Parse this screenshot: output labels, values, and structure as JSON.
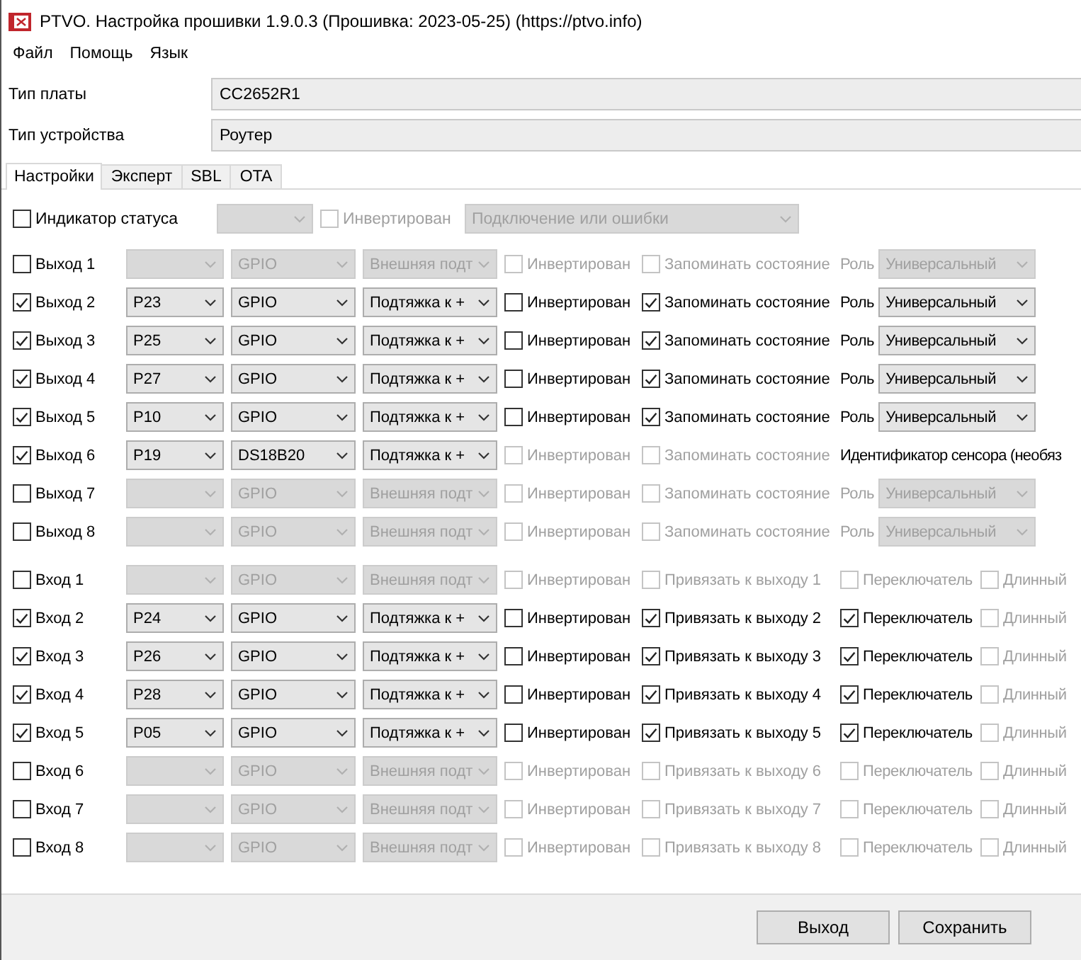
{
  "window": {
    "title": "PTVO. Настройка прошивки 1.9.0.3 (Прошивка: 2023-05-25) (https://ptvo.info)"
  },
  "menu": [
    "Файл",
    "Помощь",
    "Язык"
  ],
  "fields": [
    {
      "label": "Тип платы",
      "value": "CC2652R1"
    },
    {
      "label": "Тип устройства",
      "value": "Роутер"
    }
  ],
  "tabs": [
    {
      "label": "Настройки",
      "selected": true
    },
    {
      "label": "Эксперт",
      "selected": false
    },
    {
      "label": "SBL",
      "selected": false
    },
    {
      "label": "OTA",
      "selected": false
    }
  ],
  "status_row": {
    "label": "Индикатор статуса",
    "checked": false,
    "invert": {
      "label": "Инвертирован",
      "checked": false,
      "disabled": true
    },
    "mode": "Подключение или ошибки"
  },
  "outputs": [
    {
      "label": "Выход 1",
      "checked": false,
      "type": "GPIO",
      "pull": "Внешняя подт",
      "options": [
        {
          "label": "Инвертирован",
          "checked": false,
          "disabled": true
        },
        {
          "label": "Запоминать состояние",
          "checked": false,
          "disabled": true
        }
      ],
      "role": {
        "kind": "select",
        "label": "Роль",
        "value": "Универсальный"
      }
    },
    {
      "label": "Выход 2",
      "checked": true,
      "pin": "P23",
      "type": "GPIO",
      "pull": "Подтяжка к +",
      "options": [
        {
          "label": "Инвертирован",
          "checked": false,
          "disabled": false
        },
        {
          "label": "Запоминать состояние",
          "checked": true,
          "disabled": false
        }
      ],
      "role": {
        "kind": "select",
        "label": "Роль",
        "value": "Универсальный"
      }
    },
    {
      "label": "Выход 3",
      "checked": true,
      "pin": "P25",
      "type": "GPIO",
      "pull": "Подтяжка к +",
      "options": [
        {
          "label": "Инвертирован",
          "checked": false,
          "disabled": false
        },
        {
          "label": "Запоминать состояние",
          "checked": true,
          "disabled": false
        }
      ],
      "role": {
        "kind": "select",
        "label": "Роль",
        "value": "Универсальный"
      }
    },
    {
      "label": "Выход 4",
      "checked": true,
      "pin": "P27",
      "type": "GPIO",
      "pull": "Подтяжка к +",
      "options": [
        {
          "label": "Инвертирован",
          "checked": false,
          "disabled": false
        },
        {
          "label": "Запоминать состояние",
          "checked": true,
          "disabled": false
        }
      ],
      "role": {
        "kind": "select",
        "label": "Роль",
        "value": "Универсальный"
      }
    },
    {
      "label": "Выход 5",
      "checked": true,
      "pin": "P10",
      "type": "GPIO",
      "pull": "Подтяжка к +",
      "options": [
        {
          "label": "Инвертирован",
          "checked": false,
          "disabled": false
        },
        {
          "label": "Запоминать состояние",
          "checked": true,
          "disabled": false
        }
      ],
      "role": {
        "kind": "select",
        "label": "Роль",
        "value": "Универсальный"
      }
    },
    {
      "label": "Выход 6",
      "checked": true,
      "pin": "P19",
      "type": "DS18B20",
      "pull": "Подтяжка к +",
      "options": [
        {
          "label": "Инвертирован",
          "checked": false,
          "disabled": true
        },
        {
          "label": "Запоминать состояние",
          "checked": false,
          "disabled": true
        }
      ],
      "role": {
        "kind": "text",
        "label": "Идентификатор сенсора (необяз"
      }
    },
    {
      "label": "Выход 7",
      "checked": false,
      "type": "GPIO",
      "pull": "Внешняя подт",
      "options": [
        {
          "label": "Инвертирован",
          "checked": false,
          "disabled": true
        },
        {
          "label": "Запоминать состояние",
          "checked": false,
          "disabled": true
        }
      ],
      "role": {
        "kind": "select",
        "label": "Роль",
        "value": "Универсальный"
      }
    },
    {
      "label": "Выход 8",
      "checked": false,
      "type": "GPIO",
      "pull": "Внешняя подт",
      "options": [
        {
          "label": "Инвертирован",
          "checked": false,
          "disabled": true
        },
        {
          "label": "Запоминать состояние",
          "checked": false,
          "disabled": true
        }
      ],
      "role": {
        "kind": "select",
        "label": "Роль",
        "value": "Универсальный"
      }
    }
  ],
  "inputs": [
    {
      "label": "Вход 1",
      "checked": false,
      "type": "GPIO",
      "pull": "Внешняя подт",
      "options": [
        {
          "label": "Инвертирован",
          "checked": false,
          "disabled": true
        },
        {
          "label": "Привязать к выходу 1",
          "checked": false,
          "disabled": true
        },
        {
          "label": "Переключатель",
          "checked": false,
          "disabled": true
        },
        {
          "label": "Длинный",
          "checked": false,
          "disabled": true
        }
      ]
    },
    {
      "label": "Вход 2",
      "checked": true,
      "pin": "P24",
      "type": "GPIO",
      "pull": "Подтяжка к +",
      "options": [
        {
          "label": "Инвертирован",
          "checked": false,
          "disabled": false
        },
        {
          "label": "Привязать к выходу 2",
          "checked": true,
          "disabled": false
        },
        {
          "label": "Переключатель",
          "checked": true,
          "disabled": false
        },
        {
          "label": "Длинный",
          "checked": false,
          "disabled": true
        }
      ]
    },
    {
      "label": "Вход 3",
      "checked": true,
      "pin": "P26",
      "type": "GPIO",
      "pull": "Подтяжка к +",
      "options": [
        {
          "label": "Инвертирован",
          "checked": false,
          "disabled": false
        },
        {
          "label": "Привязать к выходу 3",
          "checked": true,
          "disabled": false
        },
        {
          "label": "Переключатель",
          "checked": true,
          "disabled": false
        },
        {
          "label": "Длинный",
          "checked": false,
          "disabled": true
        }
      ]
    },
    {
      "label": "Вход 4",
      "checked": true,
      "pin": "P28",
      "type": "GPIO",
      "pull": "Подтяжка к +",
      "options": [
        {
          "label": "Инвертирован",
          "checked": false,
          "disabled": false
        },
        {
          "label": "Привязать к выходу 4",
          "checked": true,
          "disabled": false
        },
        {
          "label": "Переключатель",
          "checked": true,
          "disabled": false
        },
        {
          "label": "Длинный",
          "checked": false,
          "disabled": true
        }
      ]
    },
    {
      "label": "Вход 5",
      "checked": true,
      "pin": "P05",
      "type": "GPIO",
      "pull": "Подтяжка к +",
      "options": [
        {
          "label": "Инвертирован",
          "checked": false,
          "disabled": false
        },
        {
          "label": "Привязать к выходу 5",
          "checked": true,
          "disabled": false
        },
        {
          "label": "Переключатель",
          "checked": true,
          "disabled": false
        },
        {
          "label": "Длинный",
          "checked": false,
          "disabled": true
        }
      ]
    },
    {
      "label": "Вход 6",
      "checked": false,
      "type": "GPIO",
      "pull": "Внешняя подт",
      "options": [
        {
          "label": "Инвертирован",
          "checked": false,
          "disabled": true
        },
        {
          "label": "Привязать к выходу 6",
          "checked": false,
          "disabled": true
        },
        {
          "label": "Переключатель",
          "checked": false,
          "disabled": true
        },
        {
          "label": "Длинный",
          "checked": false,
          "disabled": true
        }
      ]
    },
    {
      "label": "Вход 7",
      "checked": false,
      "type": "GPIO",
      "pull": "Внешняя подт",
      "options": [
        {
          "label": "Инвертирован",
          "checked": false,
          "disabled": true
        },
        {
          "label": "Привязать к выходу 7",
          "checked": false,
          "disabled": true
        },
        {
          "label": "Переключатель",
          "checked": false,
          "disabled": true
        },
        {
          "label": "Длинный",
          "checked": false,
          "disabled": true
        }
      ]
    },
    {
      "label": "Вход 8",
      "checked": false,
      "type": "GPIO",
      "pull": "Внешняя подт",
      "options": [
        {
          "label": "Инвертирован",
          "checked": false,
          "disabled": true
        },
        {
          "label": "Привязать к выходу 8",
          "checked": false,
          "disabled": true
        },
        {
          "label": "Переключатель",
          "checked": false,
          "disabled": true
        },
        {
          "label": "Длинный",
          "checked": false,
          "disabled": true
        }
      ]
    }
  ],
  "buttons": [
    "Выход",
    "Сохранить"
  ]
}
